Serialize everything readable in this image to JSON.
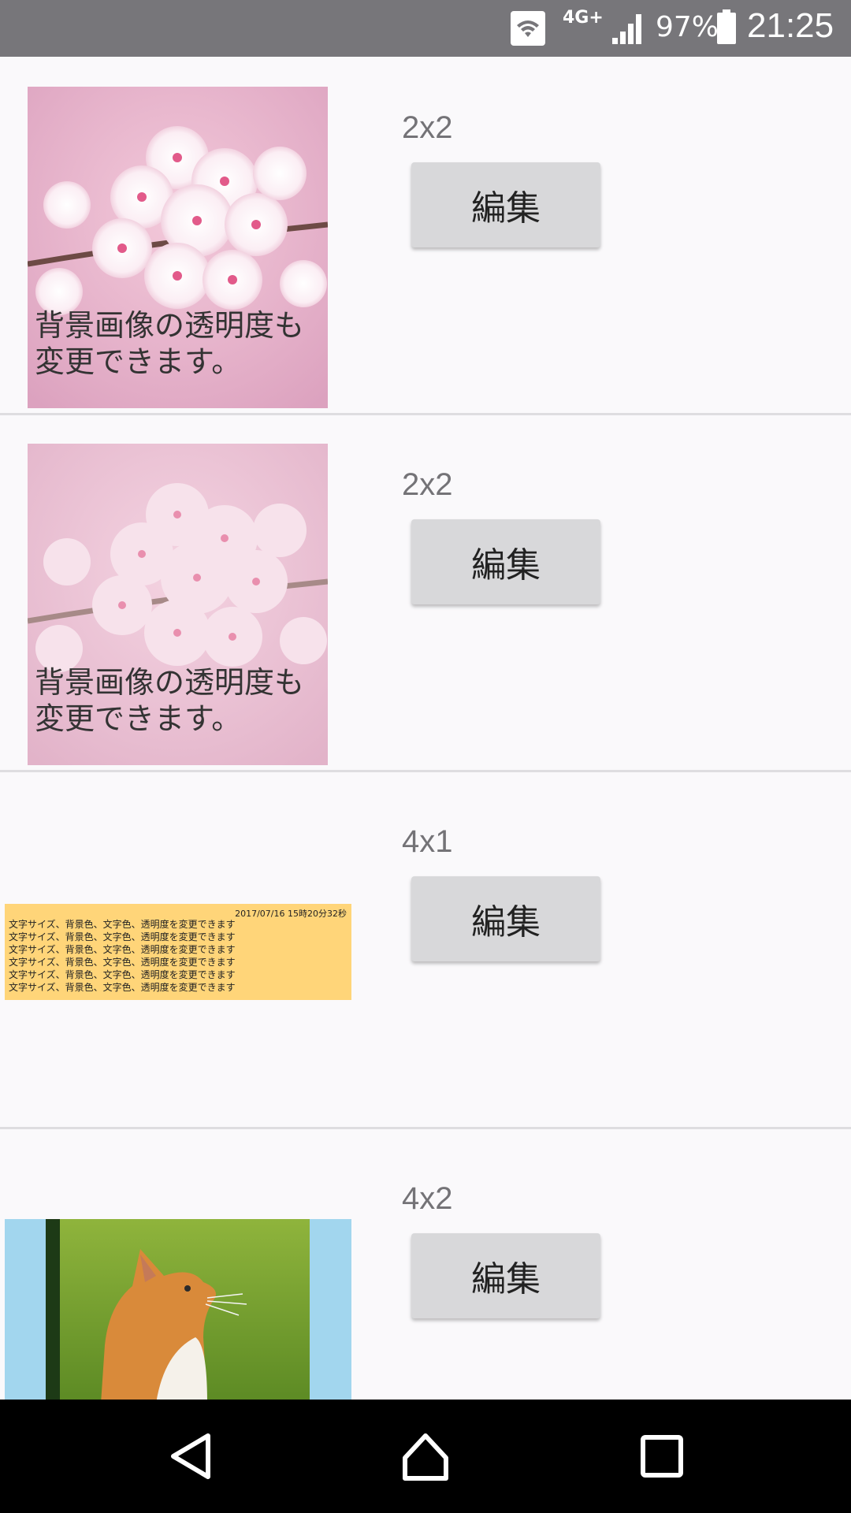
{
  "status_bar": {
    "network": "4G+",
    "battery_percent": "97%",
    "time": "21:25",
    "icons": [
      "wifi-icon",
      "signal-icon",
      "battery-icon"
    ]
  },
  "widgets": [
    {
      "size": "2x2",
      "edit_label": "編集",
      "preview_text": "背景画像の透明度も\n変更できます。"
    },
    {
      "size": "2x2",
      "edit_label": "編集",
      "preview_text": "背景画像の透明度も\n変更できます。"
    },
    {
      "size": "4x1",
      "edit_label": "編集",
      "date_text": "2017/07/16  15時20分32秒",
      "body_lines": [
        "文字サイズ、背景色、文字色、透明度を変更できます",
        "文字サイズ、背景色、文字色、透明度を変更できます",
        "文字サイズ、背景色、文字色、透明度を変更できます",
        "文字サイズ、背景色、文字色、透明度を変更できます",
        "文字サイズ、背景色、文字色、透明度を変更できます",
        "文字サイズ、背景色、文字色、透明度を変更できます"
      ]
    },
    {
      "size": "4x2",
      "edit_label": "編集"
    }
  ],
  "nav_bar": {
    "icons": [
      "back-icon",
      "home-icon",
      "recents-icon"
    ]
  },
  "colors": {
    "status_bar": "#77767a",
    "background": "#faf9fb",
    "button": "#d8d8da",
    "wide_widget_bg": "#ffd579",
    "cat_widget_bg": "#a2d6ee"
  }
}
